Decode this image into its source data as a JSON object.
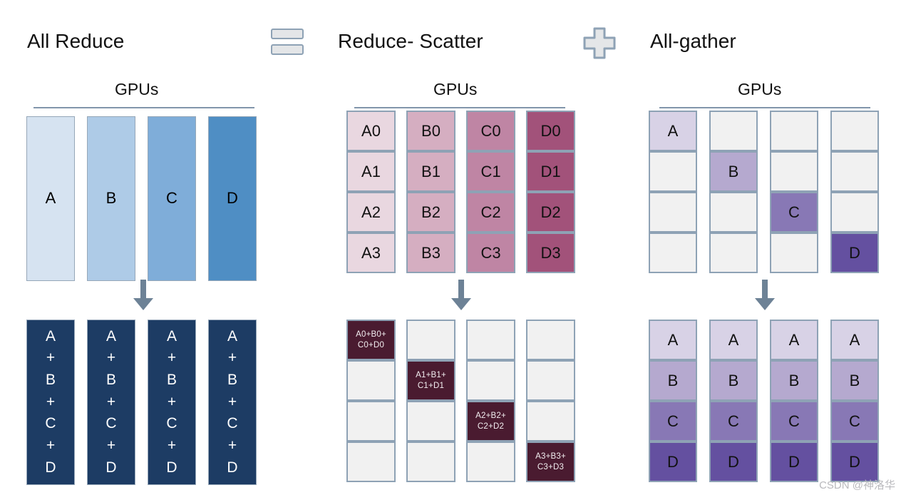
{
  "panels": {
    "all_reduce": {
      "title": "All Reduce",
      "gpus_label": "GPUs",
      "top_cells": [
        "A",
        "B",
        "C",
        "D"
      ],
      "top_colors": [
        "#d6e3f1",
        "#aecbe7",
        "#7fadd9",
        "#4f8ec4"
      ],
      "bottom_cells": [
        "A\n+\nB\n+\nC\n+\nD",
        "A\n+\nB\n+\nC\n+\nD",
        "A\n+\nB\n+\nC\n+\nD",
        "A\n+\nB\n+\nC\n+\nD"
      ],
      "bottom_color": "#1d3c64",
      "arrow_color": "#6d8296"
    },
    "reduce_scatter": {
      "title": "Reduce- Scatter",
      "gpus_label": "GPUs",
      "column_colors": [
        "#e9d7e0",
        "#d5aec1",
        "#bf85a4",
        "#a2527a"
      ],
      "grid": [
        [
          "A0",
          "B0",
          "C0",
          "D0"
        ],
        [
          "A1",
          "B1",
          "C1",
          "D1"
        ],
        [
          "A2",
          "B2",
          "C2",
          "D2"
        ],
        [
          "A3",
          "B3",
          "C3",
          "D3"
        ]
      ],
      "result_labels": [
        "A0+B0+\nC0+D0",
        "A1+B1+\nC1+D1",
        "A2+B2+\nC2+D2",
        "A3+B3+\nC3+D3"
      ],
      "result_color": "#4a1b30",
      "empty_color": "#f1f1f1",
      "arrow_color": "#6d8296"
    },
    "all_gather": {
      "title": "All-gather",
      "gpus_label": "GPUs",
      "diagonal_labels": [
        "A",
        "B",
        "C",
        "D"
      ],
      "row_colors": [
        "#d8d2e6",
        "#b5a9cf",
        "#8878b5",
        "#6450a0"
      ],
      "result_grid": [
        [
          "A",
          "A",
          "A",
          "A"
        ],
        [
          "B",
          "B",
          "B",
          "B"
        ],
        [
          "C",
          "C",
          "C",
          "C"
        ],
        [
          "D",
          "D",
          "D",
          "D"
        ]
      ],
      "empty_color": "#f1f1f1",
      "arrow_color": "#6d8296"
    }
  },
  "operators": {
    "equals": "equals-sign",
    "plus": "plus-sign"
  },
  "watermark": "CSDN @神洛华"
}
